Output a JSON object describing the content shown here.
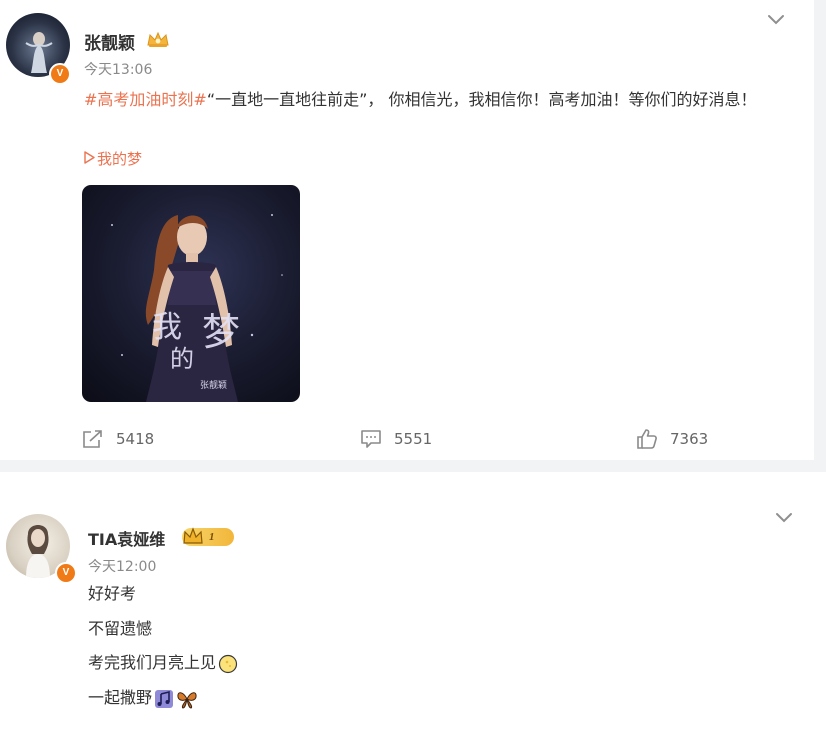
{
  "post1": {
    "user_name": "张靓颖",
    "time": "今天13:06",
    "hashtag": "#高考加油时刻#",
    "text": "“一直地一直地往前走”， 你相信光，我相信你！高考加油！等你们的好消息！",
    "music_link": "我的梦",
    "cover": {
      "title_chars": [
        "我",
        "的",
        "梦"
      ],
      "artist": "张靓颖"
    },
    "stats": {
      "reposts": "5418",
      "comments": "5551",
      "likes": "7363"
    }
  },
  "post2": {
    "user_name": "TIA袁娅维",
    "vip_level": "1",
    "time": "今天12:00",
    "lines": [
      "好好考",
      "不留遗憾",
      "考完我们月亮上见",
      "一起撒野"
    ]
  },
  "icons": [
    "verified-badge-icon",
    "crown-icon",
    "chevron-down-icon",
    "repost-icon",
    "comment-icon",
    "like-icon",
    "play-icon",
    "moon-emoji-icon",
    "music-note-emoji-icon",
    "butterfly-emoji-icon"
  ],
  "colors": {
    "link": "#eb7350",
    "verified": "#f07a16",
    "muted": "#8a8a8a",
    "divider": "#f2f3f5"
  }
}
